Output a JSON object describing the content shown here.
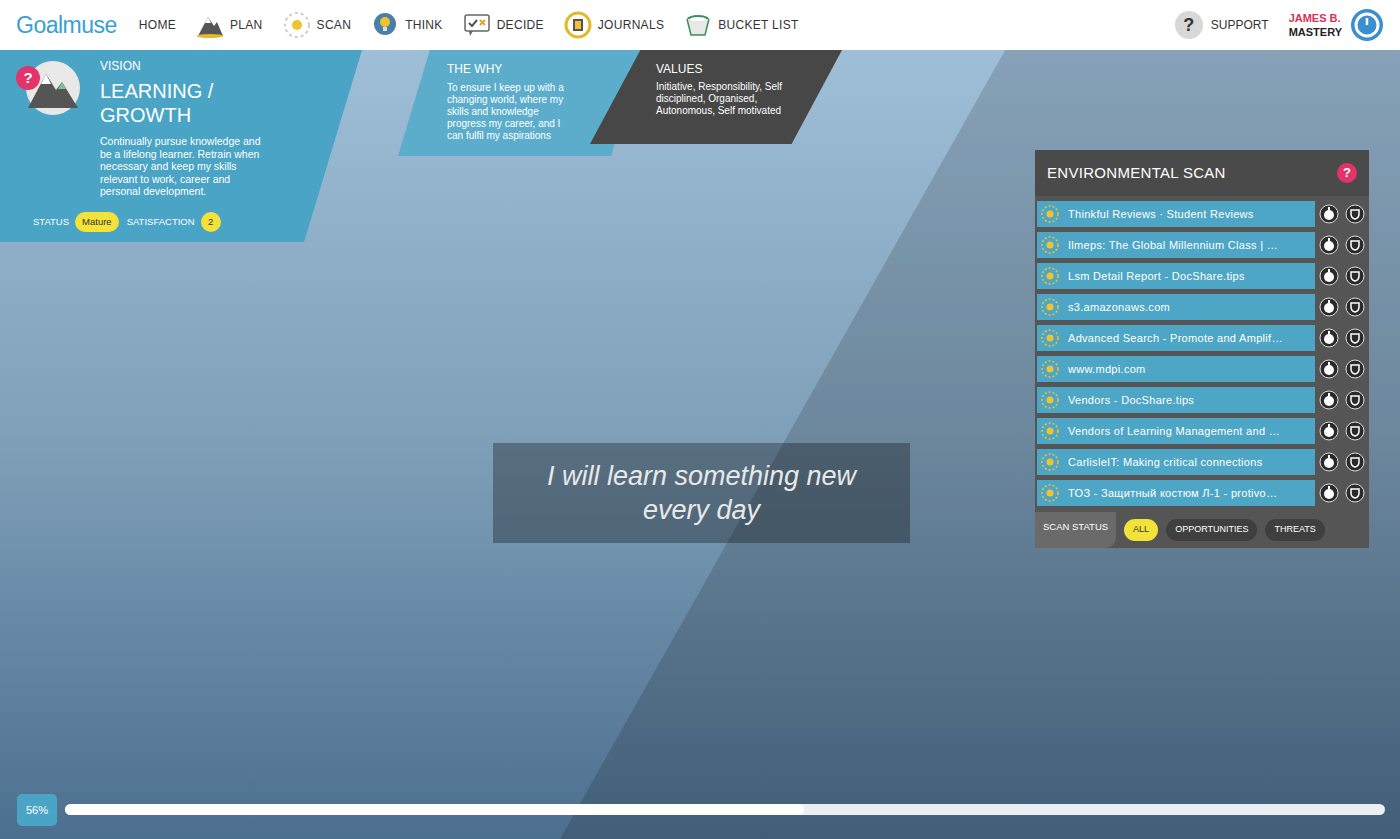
{
  "nav": {
    "logo": "Goalmuse",
    "items": [
      {
        "label": "HOME",
        "kind": "home"
      },
      {
        "label": "PLAN",
        "kind": "plan"
      },
      {
        "label": "SCAN",
        "kind": "scan"
      },
      {
        "label": "THINK",
        "kind": "think"
      },
      {
        "label": "DECIDE",
        "kind": "decide"
      },
      {
        "label": "JOURNALS",
        "kind": "journals"
      },
      {
        "label": "BUCKET LIST",
        "kind": "bucket"
      }
    ],
    "support": {
      "icon": "?",
      "label": "SUPPORT"
    },
    "user": {
      "name": "JAMES B.",
      "subtitle": "MASTERY"
    }
  },
  "vision": {
    "help": "?",
    "heading": "VISION",
    "title": "LEARNING / GROWTH",
    "description": "Continually pursue knowledge and be a lifelong learner. Retrain when necessary and keep my skills relevant to work, career and personal development.",
    "status_label": "STATUS",
    "status": "Mature",
    "satisfaction_label": "SATISFACTION",
    "satisfaction": "2"
  },
  "why": {
    "heading": "THE WHY",
    "text": "To ensure I keep up with a changing world, where my skills and knowledge progress my career, and I can fulfil my aspirations"
  },
  "values": {
    "heading": "VALUES",
    "text": "Initiative, Responsibility, Self disciplined, Organised, Autonomous, Self motivated"
  },
  "quote": "I will learn something new every day",
  "scan": {
    "title": "ENVIRONMENTAL SCAN",
    "help": "?",
    "items": [
      "Thinkful Reviews · Student Reviews",
      "Ilmeps: The Global Millennium Class | …",
      "Lsm Detail Report - DocShare.tips",
      "s3.amazonaws.com",
      "Advanced Search - Promote and Amplif…",
      "www.mdpi.com",
      "Vendors - DocShare.tips",
      "Vendors of Learning Management and …",
      "CarlisleIT: Making critical connections",
      "ТОЗ - Защитный костюм Л-1 - protivo…"
    ],
    "status_label": "SCAN STATUS",
    "filters": [
      {
        "label": "ALL",
        "selected": true
      },
      {
        "label": "OPPORTUNITIES",
        "selected": false
      },
      {
        "label": "THREATS",
        "selected": false
      }
    ]
  },
  "progress": {
    "reading": "56%",
    "level": 0.56
  }
}
